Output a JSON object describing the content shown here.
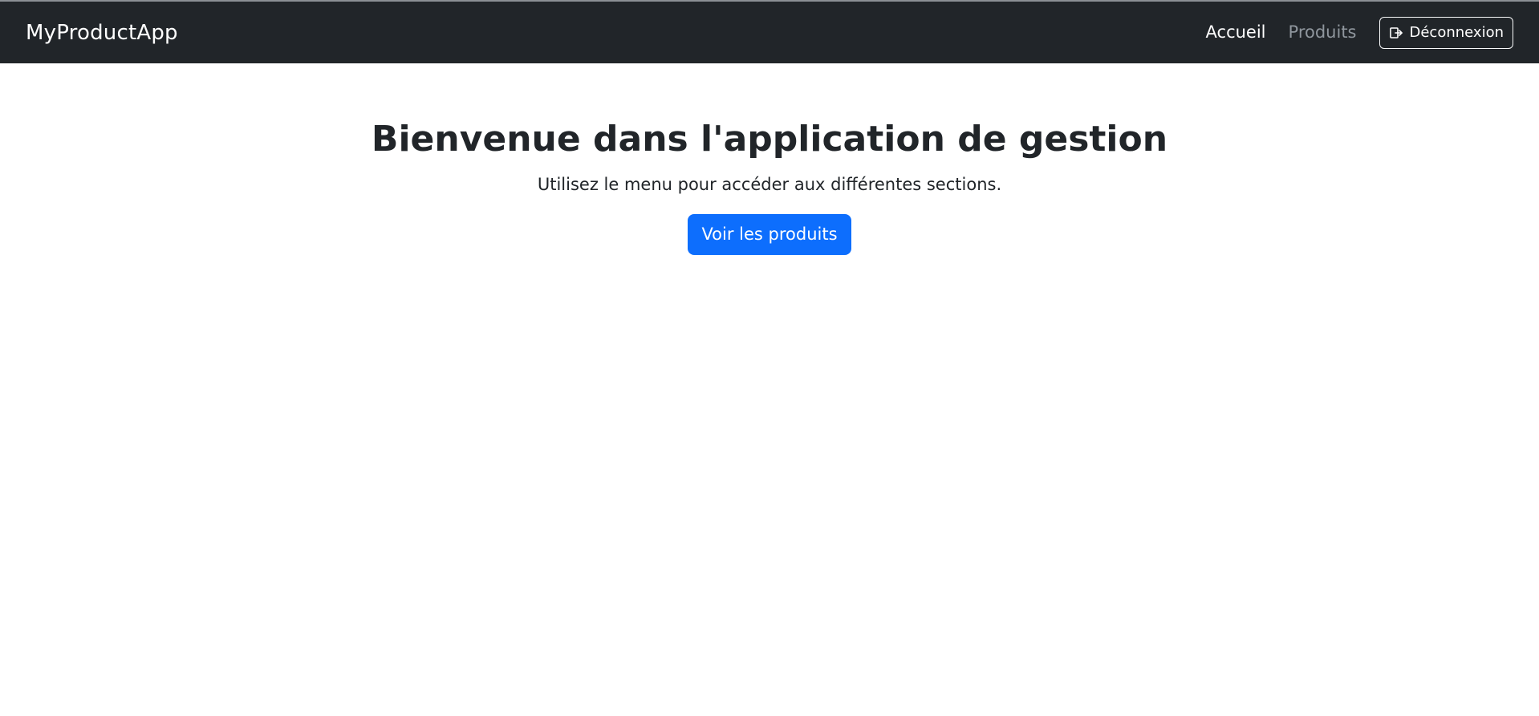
{
  "app": {
    "brand": "MyProductApp"
  },
  "navbar": {
    "links": [
      {
        "label": "Accueil",
        "state": "active"
      },
      {
        "label": "Produits",
        "state": "inactive"
      }
    ],
    "logout": {
      "label": "Déconnexion",
      "icon": "logout-icon"
    }
  },
  "hero": {
    "title": "Bienvenue dans l'application de gestion",
    "subtitle": "Utilisez le menu pour accéder aux différentes sections.",
    "button_label": "Voir les produits"
  },
  "colors": {
    "navbar_background": "#212529",
    "primary": "#0d6efd",
    "text": "#212529",
    "inactive_link": "#8f969d"
  }
}
